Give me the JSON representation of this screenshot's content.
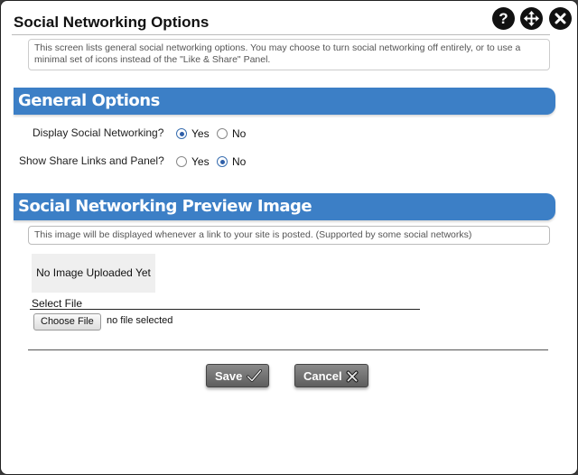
{
  "dialog": {
    "title": "Social Networking Options",
    "description": "This screen lists general social networking options. You may choose to turn social networking off entirely, or to use a minimal set of icons instead of the \"Like & Share\" Panel."
  },
  "title_buttons": {
    "help_glyph": "?",
    "help_icon": "help-icon",
    "move_icon": "move-icon",
    "close_icon": "close-icon"
  },
  "general_options": {
    "heading": "General Options",
    "display_social": {
      "label": "Display Social Networking?",
      "yes": "Yes",
      "no": "No",
      "selected": "Yes"
    },
    "share_links": {
      "label": "Show Share Links and Panel?",
      "yes": "Yes",
      "no": "No",
      "selected": "No"
    }
  },
  "preview_image": {
    "heading": "Social Networking Preview Image",
    "hint": "This image will be displayed whenever a link to your site is posted. (Supported by some social networks)",
    "placeholder": "No Image Uploaded Yet",
    "select_label": "Select File",
    "choose_button": "Choose File",
    "file_status": "no file selected"
  },
  "actions": {
    "save": "Save",
    "cancel": "Cancel"
  },
  "colors": {
    "section_header": "#3c7fc6",
    "button_gray": "#6e6e6e"
  }
}
